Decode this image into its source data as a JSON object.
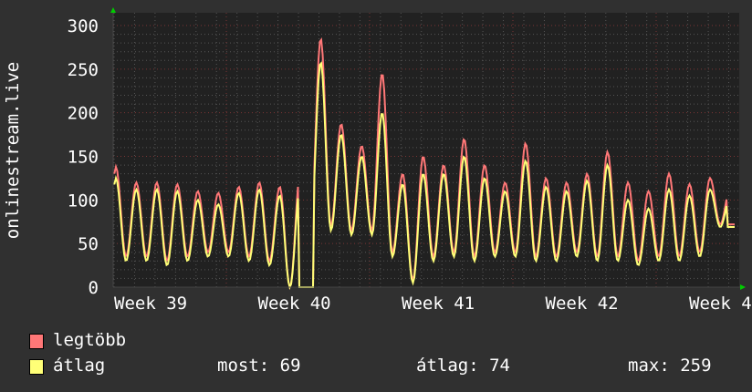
{
  "chart_data": {
    "type": "line",
    "y_axis_title": "onlinestream.live",
    "ylim": [
      0,
      300
    ],
    "y_ticks": [
      "0",
      "50",
      "100",
      "150",
      "200",
      "250",
      "300"
    ],
    "x_tick_labels": [
      "Week 39",
      "Week 40",
      "Week 41",
      "Week 42",
      "Week 4"
    ],
    "x_unit": "day",
    "grid": true,
    "series": [
      {
        "name": "legtöbb",
        "color": "#ff7777",
        "daily_peaks": [
          138,
          120,
          120,
          118,
          110,
          108,
          115,
          120,
          115,
          130,
          285,
          187,
          162,
          245,
          130,
          150,
          140,
          170,
          140,
          120,
          165,
          125,
          120,
          130,
          155,
          120,
          110,
          130,
          118,
          125,
          115
        ],
        "daily_troughs": [
          40,
          35,
          35,
          30,
          35,
          40,
          40,
          35,
          30,
          0,
          70,
          70,
          65,
          65,
          40,
          8,
          35,
          40,
          35,
          40,
          40,
          35,
          35,
          40,
          35,
          35,
          30,
          35,
          35,
          40,
          72
        ]
      },
      {
        "name": "átlag",
        "color": "#ffff77",
        "daily_peaks": [
          125,
          112,
          112,
          110,
          100,
          95,
          108,
          112,
          105,
          115,
          258,
          175,
          150,
          200,
          118,
          130,
          130,
          150,
          125,
          110,
          145,
          115,
          110,
          122,
          140,
          100,
          90,
          112,
          105,
          112,
          105
        ],
        "daily_troughs": [
          35,
          30,
          30,
          25,
          30,
          35,
          35,
          30,
          25,
          0,
          65,
          65,
          60,
          60,
          35,
          5,
          30,
          35,
          30,
          35,
          35,
          30,
          30,
          35,
          30,
          30,
          25,
          30,
          30,
          35,
          69
        ]
      }
    ]
  },
  "legend": {
    "items": [
      {
        "label": "legtöbb",
        "color": "#ff7777"
      },
      {
        "label": "átlag",
        "color": "#ffff77"
      }
    ],
    "stats": {
      "now": "most: 69",
      "avg": "átlag: 74",
      "max": "max: 259"
    }
  }
}
